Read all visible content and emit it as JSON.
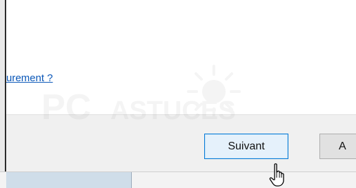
{
  "dialog": {
    "help_link": "urement ?",
    "buttons": {
      "next": "Suivant",
      "cancel": "A"
    }
  },
  "watermark": {
    "text": "PCASTUCES"
  },
  "icons": {
    "cursor": "hand-pointer-icon",
    "watermark_logo": "sun-face-logo"
  },
  "colors": {
    "link": "#0a57b8",
    "focus_border": "#0078d7",
    "footer": "#f0f0f0"
  }
}
